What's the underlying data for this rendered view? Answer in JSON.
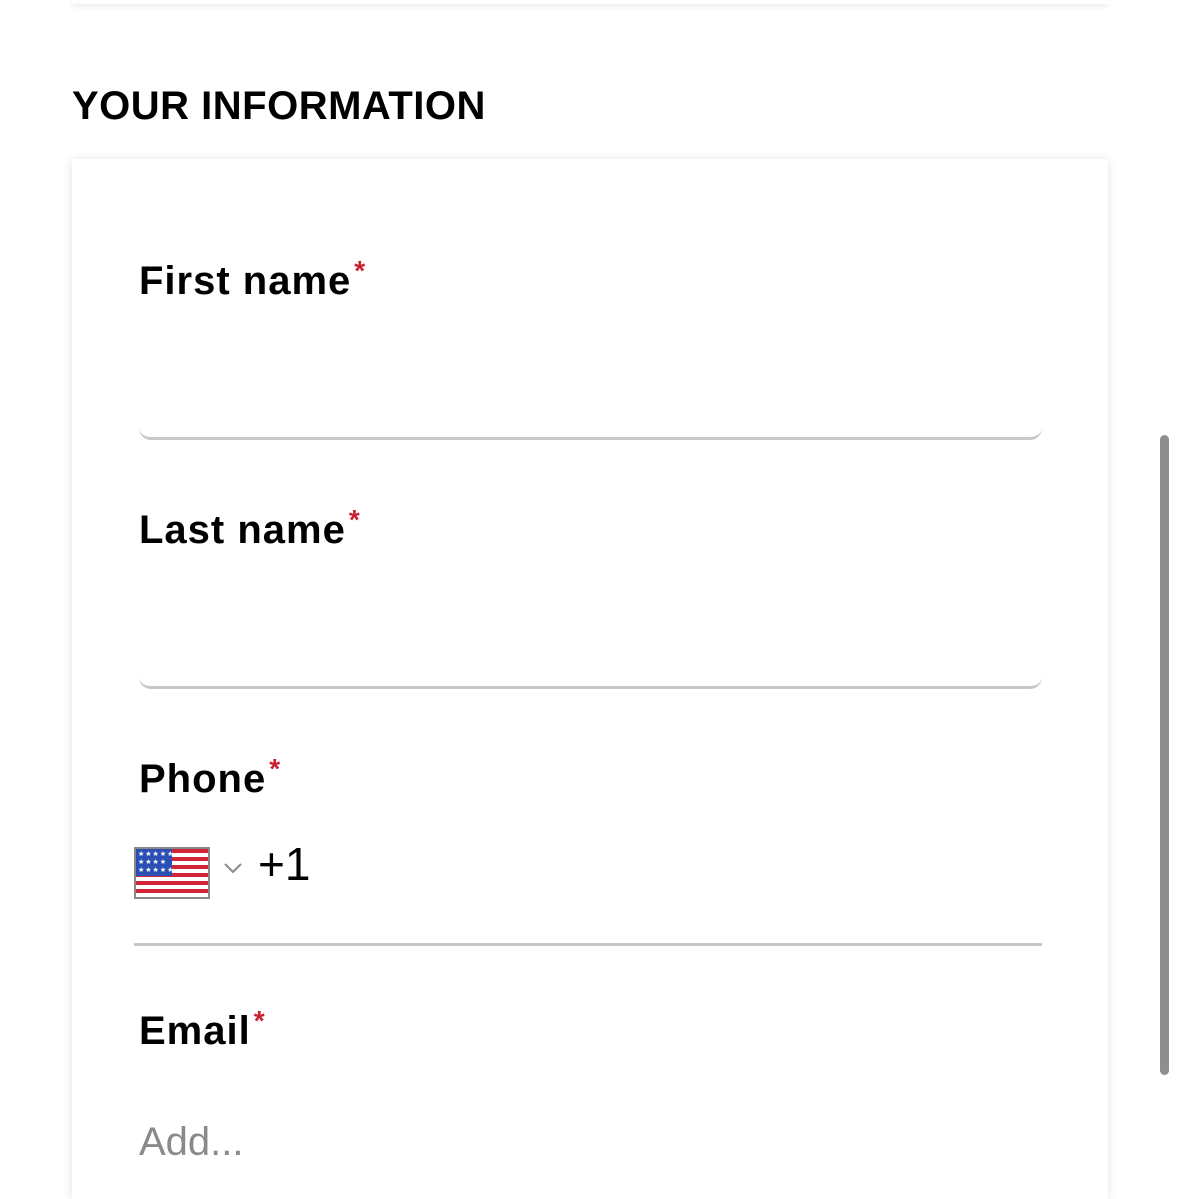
{
  "section": {
    "title": "YOUR INFORMATION"
  },
  "form": {
    "required_marker": "*",
    "first_name": {
      "label": "First name",
      "value": ""
    },
    "last_name": {
      "label": "Last name",
      "value": ""
    },
    "phone": {
      "label": "Phone",
      "country_flag": "us-flag-icon",
      "dial_code": "+1"
    },
    "email": {
      "label": "Email",
      "placeholder": "Add..."
    }
  },
  "colors": {
    "required": "#c8202f",
    "input_underline": "#c8c8c8",
    "placeholder": "#8a8a8a",
    "scrollbar": "#8e8e8e"
  }
}
